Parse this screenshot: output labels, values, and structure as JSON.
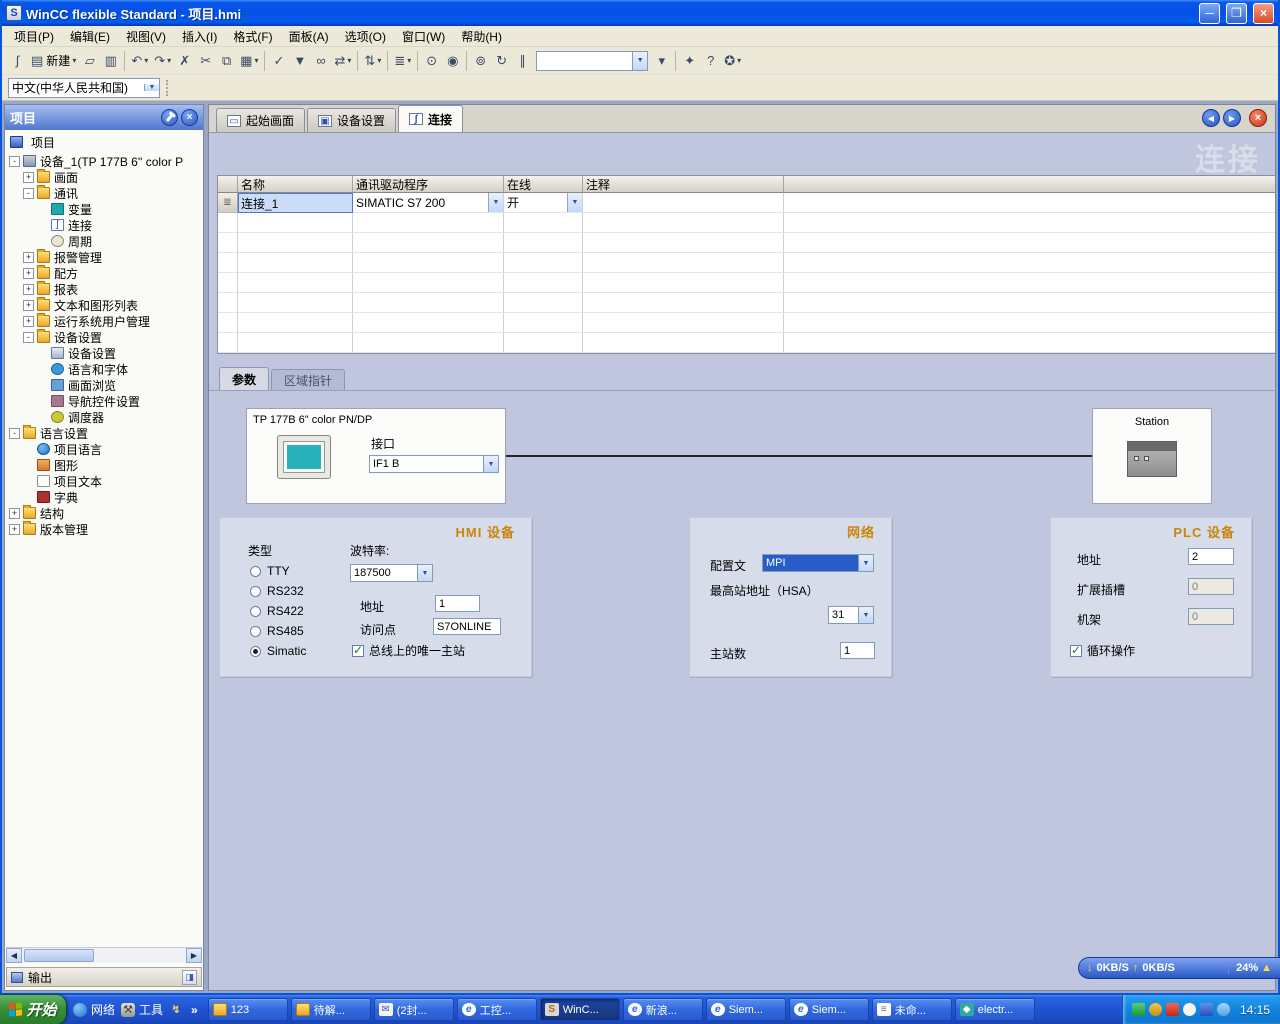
{
  "window": {
    "title": "WinCC flexible Standard - 项目.hmi"
  },
  "menubar": {
    "items": [
      "项目(P)",
      "编辑(E)",
      "视图(V)",
      "插入(I)",
      "格式(F)",
      "面板(A)",
      "选项(O)",
      "窗口(W)",
      "帮助(H)"
    ]
  },
  "toolbar": {
    "search_combo_value": "",
    "buttons": [
      {
        "icon": "s-curve-icon"
      },
      {
        "icon": "new-icon",
        "label": "新建",
        "dd": true
      },
      {
        "icon": "open-folder-icon"
      },
      {
        "icon": "paste-icon"
      },
      {
        "sep": true
      },
      {
        "icon": "undo-icon",
        "dd": true
      },
      {
        "icon": "redo-icon",
        "dd": true
      },
      {
        "icon": "delete-icon"
      },
      {
        "icon": "cut-icon"
      },
      {
        "icon": "copy-icon"
      },
      {
        "icon": "paste-special-icon",
        "dd": true
      },
      {
        "sep": true
      },
      {
        "icon": "compile-icon"
      },
      {
        "icon": "download-icon"
      },
      {
        "icon": "connect-icon"
      },
      {
        "icon": "transfer-icon",
        "dd": true
      },
      {
        "sep": true
      },
      {
        "icon": "sort-icon",
        "dd": true
      },
      {
        "sep": true
      },
      {
        "icon": "list-icon",
        "dd": true
      },
      {
        "sep": true
      },
      {
        "icon": "find-icon"
      },
      {
        "icon": "find-next-icon"
      },
      {
        "sep": true
      },
      {
        "icon": "binocular-icon"
      },
      {
        "icon": "refresh-icon"
      },
      {
        "icon": "pause-icon"
      },
      {
        "combo": true
      },
      {
        "icon": "dropdown-icon"
      },
      {
        "sep": true
      },
      {
        "icon": "seal-icon"
      },
      {
        "icon": "help-icon"
      },
      {
        "icon": "key-icon",
        "dd": true
      }
    ]
  },
  "language_bar": {
    "value": "中文(中华人民共和国)"
  },
  "project_panel": {
    "title": "项目",
    "root_label": "项目",
    "output_label": "输出",
    "tree": [
      {
        "label": "设备_1(TP 177B 6'' color P",
        "level": 1,
        "expander": "-",
        "icon": "device"
      },
      {
        "label": "画面",
        "level": 2,
        "expander": "+",
        "icon": "folder"
      },
      {
        "label": "通讯",
        "level": 2,
        "expander": "-",
        "icon": "folder"
      },
      {
        "label": "变量",
        "level": 3,
        "expander": "",
        "icon": "tag"
      },
      {
        "label": "连接",
        "level": 3,
        "expander": "",
        "icon": "connection"
      },
      {
        "label": "周期",
        "level": 3,
        "expander": "",
        "icon": "cycle"
      },
      {
        "label": "报警管理",
        "level": 2,
        "expander": "+",
        "icon": "folder"
      },
      {
        "label": "配方",
        "level": 2,
        "expander": "+",
        "icon": "folder"
      },
      {
        "label": "报表",
        "level": 2,
        "expander": "+",
        "icon": "folder"
      },
      {
        "label": "文本和图形列表",
        "level": 2,
        "expander": "+",
        "icon": "folder"
      },
      {
        "label": "运行系统用户管理",
        "level": 2,
        "expander": "+",
        "icon": "folder"
      },
      {
        "label": "设备设置",
        "level": 2,
        "expander": "-",
        "icon": "folder"
      },
      {
        "label": "设备设置",
        "level": 3,
        "expander": "",
        "icon": "settings"
      },
      {
        "label": "语言和字体",
        "level": 3,
        "expander": "",
        "icon": "language"
      },
      {
        "label": "画面浏览",
        "level": 3,
        "expander": "",
        "icon": "screen"
      },
      {
        "label": "导航控件设置",
        "level": 3,
        "expander": "",
        "icon": "nav"
      },
      {
        "label": "调度器",
        "level": 3,
        "expander": "",
        "icon": "scheduler"
      },
      {
        "label": "语言设置",
        "level": 1,
        "expander": "-",
        "icon": "folder"
      },
      {
        "label": "项目语言",
        "level": 2,
        "expander": "",
        "icon": "globe"
      },
      {
        "label": "图形",
        "level": 2,
        "expander": "",
        "icon": "graphic"
      },
      {
        "label": "项目文本",
        "level": 2,
        "expander": "",
        "icon": "text"
      },
      {
        "label": "字典",
        "level": 2,
        "expander": "",
        "icon": "dict"
      },
      {
        "label": "结构",
        "level": 1,
        "expander": "+",
        "icon": "folder"
      },
      {
        "label": "版本管理",
        "level": 1,
        "expander": "+",
        "icon": "folder"
      }
    ]
  },
  "editor": {
    "tabs": [
      {
        "label": "起始画面",
        "icon": "screen",
        "active": false
      },
      {
        "label": "设备设置",
        "icon": "device",
        "active": false
      },
      {
        "label": "连接",
        "icon": "connection",
        "active": true
      }
    ],
    "watermark": "连接",
    "table": {
      "columns": [
        "名称",
        "通讯驱动程序",
        "在线",
        "注释"
      ],
      "row": {
        "name": "连接_1",
        "driver": "SIMATIC S7 200",
        "online": "开",
        "comment": ""
      },
      "empty_rows": 7
    },
    "subtabs": [
      {
        "label": "参数",
        "active": true
      },
      {
        "label": "区域指针",
        "active": false
      }
    ]
  },
  "params": {
    "hmi_box": {
      "device_name": "TP 177B 6\" color PN/DP",
      "interface_label": "接口",
      "interface_value": "IF1 B"
    },
    "station_box": {
      "label": "Station"
    },
    "hmi_group": {
      "title": "HMI 设备",
      "type_label": "类型",
      "baud_label": "波特率:",
      "types": [
        "TTY",
        "RS232",
        "RS422",
        "RS485",
        "Simatic"
      ],
      "selected_type": "Simatic",
      "baud_value": "187500",
      "address_label": "地址",
      "address_value": "1",
      "access_label": "访问点",
      "access_value": "S7ONLINE",
      "only_master_label": "总线上的唯一主站",
      "only_master_checked": true
    },
    "network_group": {
      "title": "网络",
      "profile_label": "配置文",
      "profile_value": "MPI",
      "hsa_label": "最高站地址（HSA）",
      "hsa_value": "31",
      "masters_label": "主站数",
      "masters_value": "1"
    },
    "plc_group": {
      "title": "PLC 设备",
      "address_label": "地址",
      "address_value": "2",
      "slot_label": "扩展插槽",
      "slot_value": "0",
      "rack_label": "机架",
      "rack_value": "0",
      "cyclic_label": "循环操作",
      "cyclic_checked": true
    }
  },
  "speedbar": {
    "down": "0KB/S",
    "up": "0KB/S",
    "percent": "24%"
  },
  "taskbar": {
    "start": "开始",
    "quicklaunch": [
      {
        "icon": "network-globe-icon",
        "label": "网络"
      },
      {
        "icon": "toolbox-icon",
        "label": "工具"
      },
      {
        "icon": "lightning-icon",
        "label": ""
      }
    ],
    "overflow_chevron": "»",
    "buttons": [
      {
        "label": "123",
        "icon": "folder"
      },
      {
        "label": "待解...",
        "icon": "folder"
      },
      {
        "label": "(2封...",
        "icon": "mail"
      },
      {
        "label": "工控...",
        "icon": "ie"
      },
      {
        "label": "WinC...",
        "icon": "wincc",
        "active": true
      },
      {
        "label": "新浪...",
        "icon": "ie"
      },
      {
        "label": "Siem...",
        "icon": "ie"
      },
      {
        "label": "Siem...",
        "icon": "ie"
      },
      {
        "label": "未命...",
        "icon": "doc"
      },
      {
        "label": "electr...",
        "icon": "app"
      }
    ],
    "tray_icons": [
      "tray-transfer-icon",
      "tray-alarm-icon",
      "tray-antivirus-icon",
      "tray-volume-icon",
      "tray-network-icon",
      "tray-messenger-icon"
    ],
    "clock": "14:15"
  }
}
